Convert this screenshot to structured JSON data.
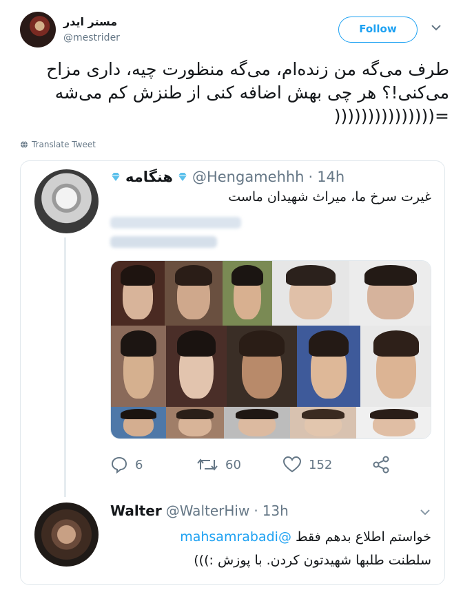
{
  "author": {
    "name": "مستر ایدر",
    "handle": "@mestrider",
    "follow_label": "Follow"
  },
  "tweet": {
    "lines": [
      "طرف می‌گه من زنده‌ام، می‌گه منظورت چیه، داری مزاح",
      "می‌کنی!؟ هر چی بهش اضافه کنی از طنزش کم می‌شه",
      "=((((((((((((((("
    ],
    "translate_label": "Translate Tweet"
  },
  "quoted": {
    "name": "هنگامه",
    "handle": "@Hengamehhh",
    "separator": "·",
    "time": "14h",
    "text": "غیرت سرخ ما، میراث شهیدان ماست",
    "actions": {
      "replies": "6",
      "retweets": "60",
      "likes": "152"
    }
  },
  "reply": {
    "name": "Walter",
    "handle": "@WalterHiw",
    "separator": "·",
    "time": "13h",
    "mention": "@mahsamrabadi",
    "text_after_mention": "خواستم اطلاع بدهم فقط",
    "text_line2": "سلطنت طلبها شهیدتون کردن. با پوزش :)))"
  },
  "colors": {
    "accent": "#1da1f2",
    "muted": "#657786",
    "border": "#e1e8ed",
    "diamond": "#5bc0eb"
  },
  "icons": [
    "chevron-down-icon",
    "globe-icon",
    "diamond-icon",
    "reply-icon",
    "retweet-icon",
    "like-icon",
    "share-icon"
  ]
}
